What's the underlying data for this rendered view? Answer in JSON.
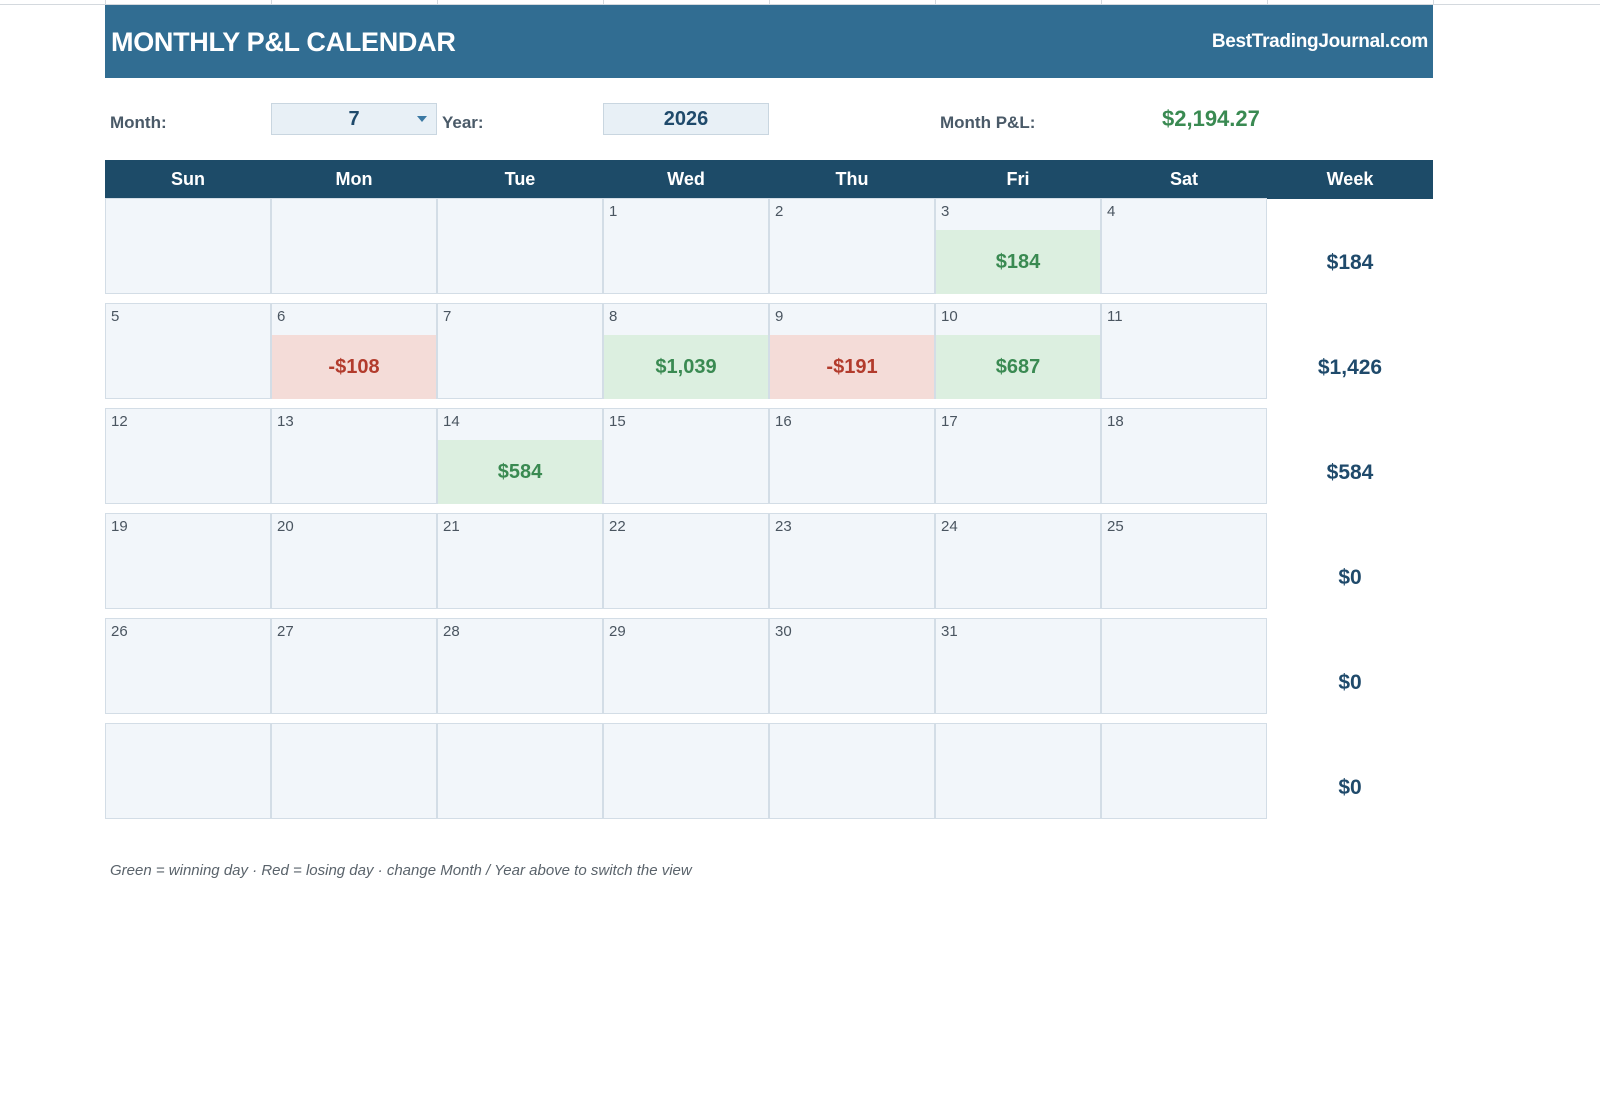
{
  "header": {
    "title": "MONTHLY P&L CALENDAR",
    "brand": "BestTradingJournal.com"
  },
  "controls": {
    "month_label": "Month:",
    "month_value": "7",
    "year_label": "Year:",
    "year_value": "2026",
    "month_pl_label": "Month P&L:",
    "month_pl_value": "$2,194.27"
  },
  "colors": {
    "banner": "#316d92",
    "header_row": "#1d4b68",
    "win_bg": "#dcefe0",
    "win_text": "#3a8a52",
    "loss_bg": "#f4dcd8",
    "loss_text": "#b23b2c"
  },
  "days_of_week": [
    "Sun",
    "Mon",
    "Tue",
    "Wed",
    "Thu",
    "Fri",
    "Sat"
  ],
  "week_header": "Week",
  "weeks": [
    {
      "days": [
        {
          "date": "",
          "pnl": "",
          "status": ""
        },
        {
          "date": "",
          "pnl": "",
          "status": ""
        },
        {
          "date": "",
          "pnl": "",
          "status": ""
        },
        {
          "date": "1",
          "pnl": "",
          "status": ""
        },
        {
          "date": "2",
          "pnl": "",
          "status": ""
        },
        {
          "date": "3",
          "pnl": "$184",
          "status": "win"
        },
        {
          "date": "4",
          "pnl": "",
          "status": ""
        }
      ],
      "total": "$184"
    },
    {
      "days": [
        {
          "date": "5",
          "pnl": "",
          "status": ""
        },
        {
          "date": "6",
          "pnl": "-$108",
          "status": "loss"
        },
        {
          "date": "7",
          "pnl": "",
          "status": ""
        },
        {
          "date": "8",
          "pnl": "$1,039",
          "status": "win"
        },
        {
          "date": "9",
          "pnl": "-$191",
          "status": "loss"
        },
        {
          "date": "10",
          "pnl": "$687",
          "status": "win"
        },
        {
          "date": "11",
          "pnl": "",
          "status": ""
        }
      ],
      "total": "$1,426"
    },
    {
      "days": [
        {
          "date": "12",
          "pnl": "",
          "status": ""
        },
        {
          "date": "13",
          "pnl": "",
          "status": ""
        },
        {
          "date": "14",
          "pnl": "$584",
          "status": "win"
        },
        {
          "date": "15",
          "pnl": "",
          "status": ""
        },
        {
          "date": "16",
          "pnl": "",
          "status": ""
        },
        {
          "date": "17",
          "pnl": "",
          "status": ""
        },
        {
          "date": "18",
          "pnl": "",
          "status": ""
        }
      ],
      "total": "$584"
    },
    {
      "days": [
        {
          "date": "19",
          "pnl": "",
          "status": ""
        },
        {
          "date": "20",
          "pnl": "",
          "status": ""
        },
        {
          "date": "21",
          "pnl": "",
          "status": ""
        },
        {
          "date": "22",
          "pnl": "",
          "status": ""
        },
        {
          "date": "23",
          "pnl": "",
          "status": ""
        },
        {
          "date": "24",
          "pnl": "",
          "status": ""
        },
        {
          "date": "25",
          "pnl": "",
          "status": ""
        }
      ],
      "total": "$0"
    },
    {
      "days": [
        {
          "date": "26",
          "pnl": "",
          "status": ""
        },
        {
          "date": "27",
          "pnl": "",
          "status": ""
        },
        {
          "date": "28",
          "pnl": "",
          "status": ""
        },
        {
          "date": "29",
          "pnl": "",
          "status": ""
        },
        {
          "date": "30",
          "pnl": "",
          "status": ""
        },
        {
          "date": "31",
          "pnl": "",
          "status": ""
        },
        {
          "date": "",
          "pnl": "",
          "status": ""
        }
      ],
      "total": "$0"
    },
    {
      "days": [
        {
          "date": "",
          "pnl": "",
          "status": ""
        },
        {
          "date": "",
          "pnl": "",
          "status": ""
        },
        {
          "date": "",
          "pnl": "",
          "status": ""
        },
        {
          "date": "",
          "pnl": "",
          "status": ""
        },
        {
          "date": "",
          "pnl": "",
          "status": ""
        },
        {
          "date": "",
          "pnl": "",
          "status": ""
        },
        {
          "date": "",
          "pnl": "",
          "status": ""
        }
      ],
      "total": "$0"
    }
  ],
  "footnote": "Green = winning day · Red = losing day · change Month / Year above to switch the view"
}
